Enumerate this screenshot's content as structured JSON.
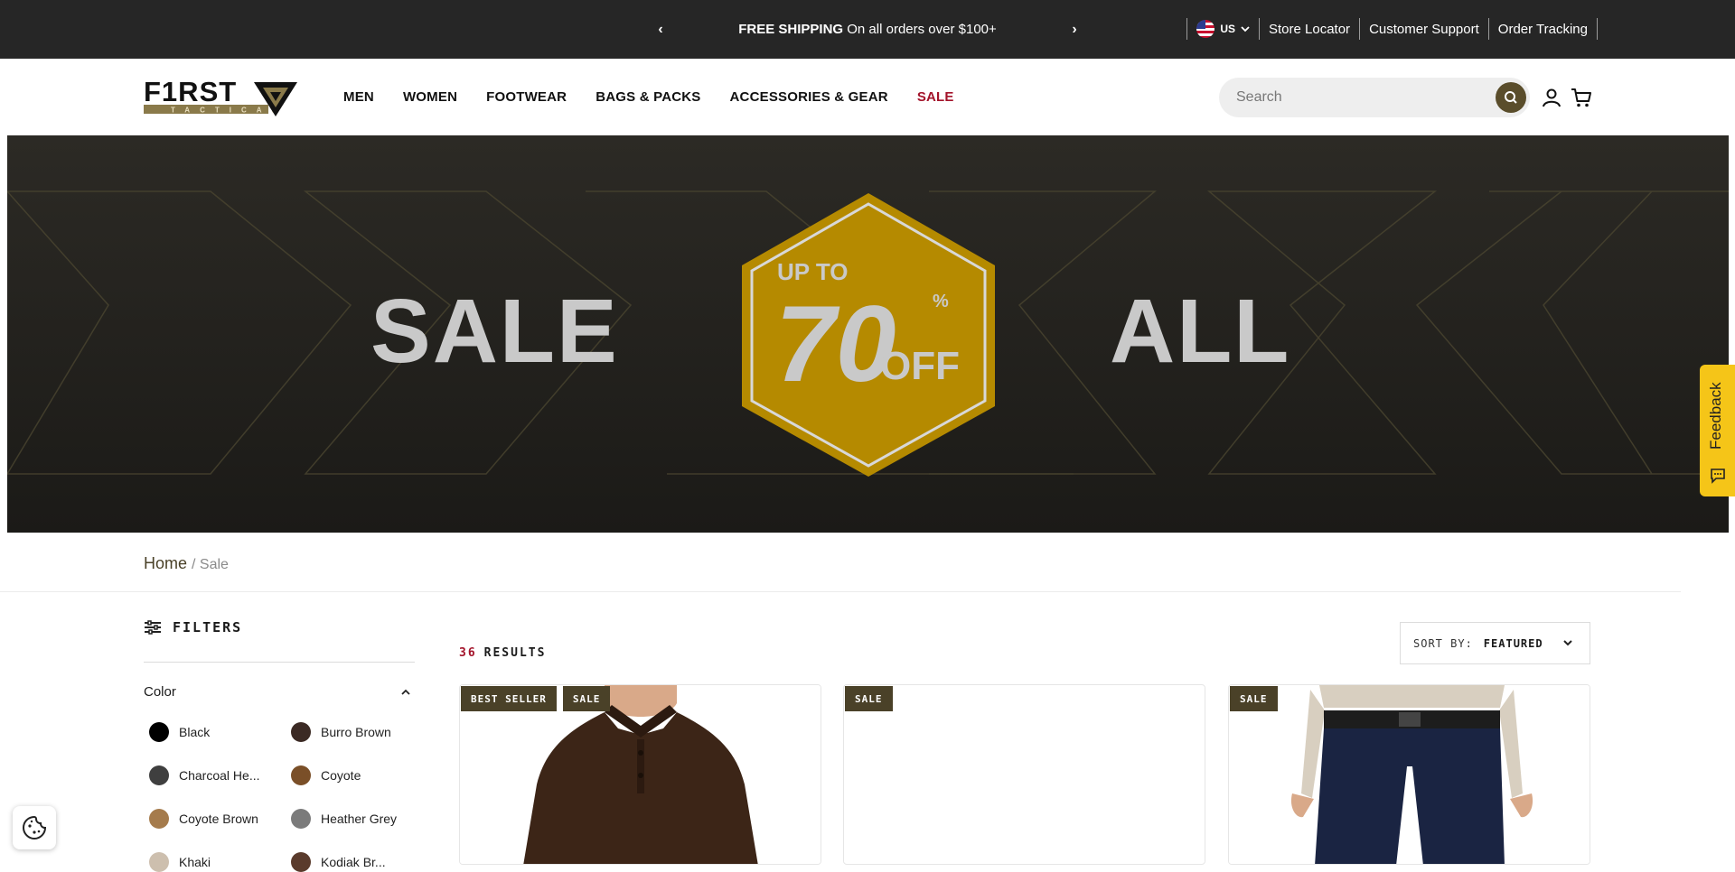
{
  "announcement": {
    "prev": "‹",
    "next": "›",
    "bold": "FREE SHIPPING",
    "text": "On all orders over $100+"
  },
  "utility": {
    "country": "US",
    "links": [
      "Store Locator",
      "Customer Support",
      "Order Tracking"
    ]
  },
  "brand": {
    "name": "F1RST",
    "tagline": "TACTICAL"
  },
  "nav": [
    "MEN",
    "WOMEN",
    "FOOTWEAR",
    "BAGS & PACKS",
    "ACCESSORIES & GEAR",
    "SALE"
  ],
  "search": {
    "placeholder": "Search"
  },
  "hero": {
    "left_word": "SALE",
    "right_word": "ALL",
    "badge_top": "UP TO",
    "badge_number": "70",
    "badge_percent": "%",
    "badge_off": "OFF",
    "colors": {
      "gold": "#b58a00",
      "grey": "#c9c9c9"
    }
  },
  "feedback": {
    "label": "Feedback"
  },
  "breadcrumb": {
    "home": "Home",
    "current": "/ Sale"
  },
  "filters": {
    "title": "FILTERS",
    "color_heading": "Color",
    "colors": [
      {
        "name": "Black",
        "hex": "#000000"
      },
      {
        "name": "Burro Brown",
        "hex": "#3b2a24"
      },
      {
        "name": "Charcoal He...",
        "hex": "#3f3f3f"
      },
      {
        "name": "Coyote",
        "hex": "#7a4f28"
      },
      {
        "name": "Coyote Brown",
        "hex": "#a57b4c"
      },
      {
        "name": "Heather Grey",
        "hex": "#7b7b7b"
      },
      {
        "name": "Khaki",
        "hex": "#cdbfae"
      },
      {
        "name": "Kodiak Br...",
        "hex": "#5a3b2c"
      }
    ]
  },
  "results": {
    "count": "36",
    "label": "RESULTS"
  },
  "sort": {
    "label": "SORT BY:",
    "value": "FEATURED"
  },
  "products": [
    {
      "badges": [
        "BEST SELLER",
        "SALE"
      ],
      "image": "brown-polo-shirt"
    },
    {
      "badges": [
        "SALE"
      ],
      "image": "blank"
    },
    {
      "badges": [
        "SALE"
      ],
      "image": "navy-tactical-pants"
    }
  ],
  "brand_colors": {
    "olive": "#4a4128",
    "sale_red": "#a3132a",
    "topbar": "#262626"
  }
}
